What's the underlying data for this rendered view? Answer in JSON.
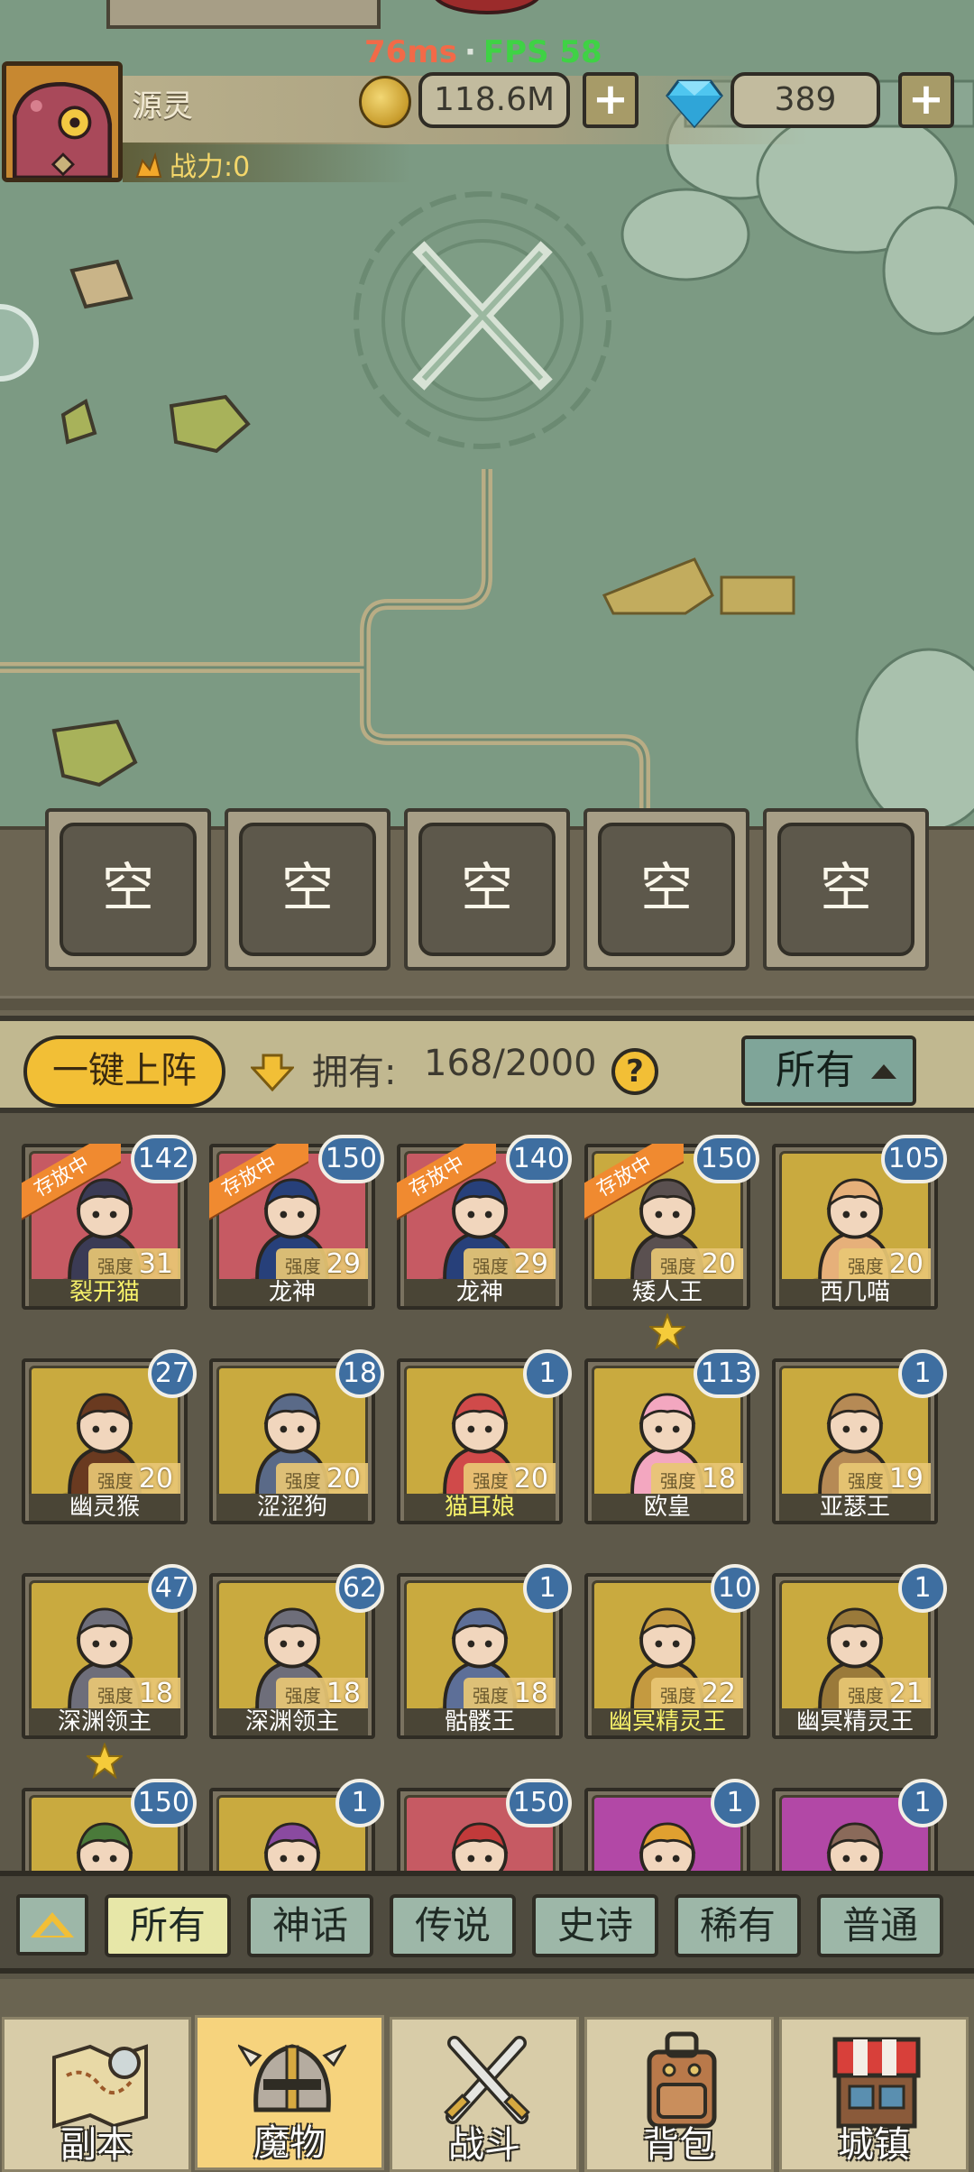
{
  "status": {
    "ping": "76ms",
    "fps": "FPS 58"
  },
  "player": {
    "name": "源灵",
    "power": "战力:0"
  },
  "resources": {
    "gold": "118.6M",
    "gems": "389"
  },
  "slots": [
    "空",
    "空",
    "空",
    "空",
    "空"
  ],
  "roster": {
    "deploy_label": "一键上阵",
    "own_label": "拥有:",
    "own_count": "168/2000",
    "help_label": "?",
    "filter_label": "所有"
  },
  "strength_label": "强度",
  "stored_label": "存放中",
  "monsters": [
    {
      "name": "裂开猫",
      "strength": "31",
      "count": "142",
      "stored": true,
      "highlight": true,
      "color": "#c65a63"
    },
    {
      "name": "龙神",
      "strength": "29",
      "count": "150",
      "stored": true,
      "highlight": false,
      "color": "#c65a63"
    },
    {
      "name": "龙神",
      "strength": "29",
      "count": "140",
      "stored": true,
      "highlight": false,
      "color": "#c65a63"
    },
    {
      "name": "矮人王",
      "strength": "20",
      "count": "150",
      "stored": true,
      "highlight": false,
      "color": "#c9aa3f",
      "star": true
    },
    {
      "name": "西几喵",
      "strength": "20",
      "count": "105",
      "stored": false,
      "highlight": false,
      "color": "#c9aa3f"
    },
    {
      "name": "幽灵猴",
      "strength": "20",
      "count": "27",
      "stored": false,
      "highlight": false,
      "color": "#c9aa3f"
    },
    {
      "name": "涩涩狗",
      "strength": "20",
      "count": "18",
      "stored": false,
      "highlight": false,
      "color": "#c9aa3f"
    },
    {
      "name": "猫耳娘",
      "strength": "20",
      "count": "1",
      "stored": false,
      "highlight": true,
      "color": "#c9aa3f"
    },
    {
      "name": "欧皇",
      "strength": "18",
      "count": "113",
      "stored": false,
      "highlight": false,
      "color": "#c9aa3f"
    },
    {
      "name": "亚瑟王",
      "strength": "19",
      "count": "1",
      "stored": false,
      "highlight": false,
      "color": "#c9aa3f"
    },
    {
      "name": "深渊领主",
      "strength": "18",
      "count": "47",
      "stored": false,
      "highlight": false,
      "color": "#c9aa3f",
      "star": true
    },
    {
      "name": "深渊领主",
      "strength": "18",
      "count": "62",
      "stored": false,
      "highlight": false,
      "color": "#c9aa3f"
    },
    {
      "name": "骷髅王",
      "strength": "18",
      "count": "1",
      "stored": false,
      "highlight": false,
      "color": "#c9aa3f"
    },
    {
      "name": "幽冥精灵王",
      "strength": "22",
      "count": "10",
      "stored": false,
      "highlight": true,
      "color": "#c9aa3f"
    },
    {
      "name": "幽冥精灵王",
      "strength": "21",
      "count": "1",
      "stored": false,
      "highlight": false,
      "color": "#c9aa3f"
    },
    {
      "name": "",
      "strength": "",
      "count": "150",
      "stored": false,
      "highlight": false,
      "color": "#c9aa3f"
    },
    {
      "name": "",
      "strength": "",
      "count": "1",
      "stored": false,
      "highlight": false,
      "color": "#c9aa3f"
    },
    {
      "name": "",
      "strength": "",
      "count": "150",
      "stored": false,
      "highlight": false,
      "color": "#c65a63"
    },
    {
      "name": "",
      "strength": "",
      "count": "1",
      "stored": false,
      "highlight": false,
      "color": "#b248a6"
    },
    {
      "name": "",
      "strength": "",
      "count": "1",
      "stored": false,
      "highlight": false,
      "color": "#b248a6"
    }
  ],
  "rarity_tabs": [
    {
      "label": "所有",
      "active": true
    },
    {
      "label": "神话",
      "active": false
    },
    {
      "label": "传说",
      "active": false
    },
    {
      "label": "史诗",
      "active": false
    },
    {
      "label": "稀有",
      "active": false
    },
    {
      "label": "普通",
      "active": false
    }
  ],
  "nav": [
    {
      "label": "副本",
      "icon": "map-icon",
      "active": false
    },
    {
      "label": "魔物",
      "icon": "helmet-icon",
      "active": true
    },
    {
      "label": "战斗",
      "icon": "swords-icon",
      "active": false
    },
    {
      "label": "背包",
      "icon": "backpack-icon",
      "active": false
    },
    {
      "label": "城镇",
      "icon": "shop-icon",
      "active": false
    }
  ],
  "colors": {
    "map_bg": "#7c9a83",
    "accent_yellow": "#f2bf36",
    "count_badge": "#3e6ea0",
    "stored_ribbon": "#f08a30",
    "tab_bg": "#9db7a8"
  }
}
